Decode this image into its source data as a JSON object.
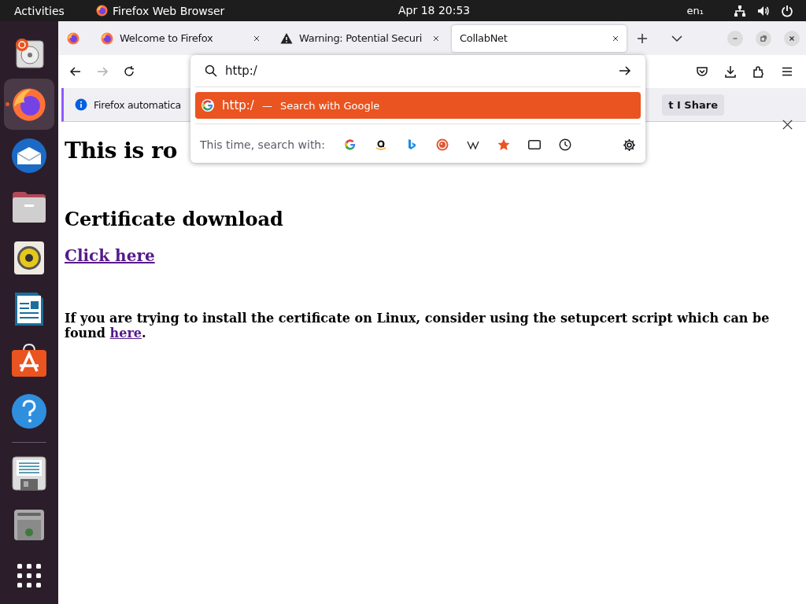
{
  "top_bar": {
    "activities": "Activities",
    "app_name": "Firefox Web Browser",
    "clock": "Apr 18  20:53",
    "input_source": "en₁"
  },
  "dock": [
    {
      "kind": "installer",
      "selected": false
    },
    {
      "kind": "firefox",
      "selected": true
    },
    {
      "kind": "mail",
      "selected": false
    },
    {
      "kind": "files",
      "selected": false
    },
    {
      "kind": "music",
      "selected": false
    },
    {
      "kind": "writer",
      "selected": false
    },
    {
      "kind": "store",
      "selected": false
    },
    {
      "kind": "help",
      "selected": false
    },
    {
      "kind": "separator",
      "selected": false
    },
    {
      "kind": "floppy",
      "selected": false
    },
    {
      "kind": "trash",
      "selected": false
    },
    {
      "kind": "apps",
      "selected": false
    }
  ],
  "tabs": [
    {
      "title": "Welcome to Firefox",
      "kind": "firefox",
      "selected": false
    },
    {
      "title": "Warning: Potential Securi",
      "kind": "warning",
      "selected": false
    },
    {
      "title": "CollabNet",
      "kind": "plain",
      "selected": true
    }
  ],
  "nav": {
    "forward_disabled": true
  },
  "notification": {
    "message": "Firefox automatica",
    "button": "t I Share"
  },
  "urlbar": {
    "value": "http:/",
    "suggestion": {
      "value": "http:/",
      "separator": "—",
      "action": "Search with Google",
      "selected": true
    },
    "engines_label": "This time, search with:",
    "engines": [
      {
        "kind": "google"
      },
      {
        "kind": "amazon"
      },
      {
        "kind": "bing"
      },
      {
        "kind": "duckduckgo"
      },
      {
        "kind": "wikipedia"
      },
      {
        "kind": "bookmarks"
      },
      {
        "kind": "tabs"
      },
      {
        "kind": "history"
      }
    ]
  },
  "page": {
    "title": "This is ro",
    "section": "Certificate download",
    "download_link": "Click here",
    "note": {
      "text": "If you are trying to install the certificate on Linux, consider using the setupcert script which can be found ",
      "link": "here",
      "after": "."
    }
  }
}
